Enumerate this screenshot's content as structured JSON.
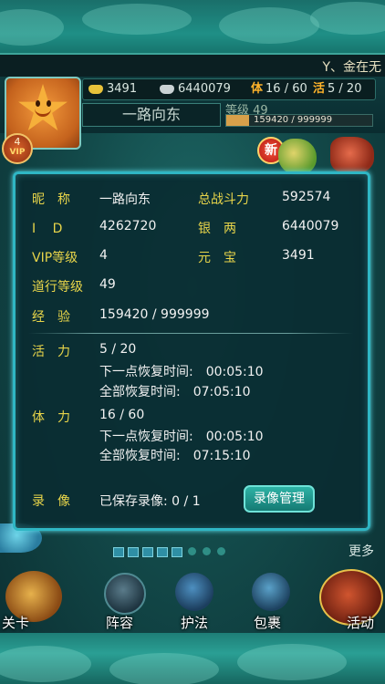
{
  "marquee": {
    "text": "Y、金在无"
  },
  "header": {
    "ingot": "3491",
    "silver": "6440079",
    "stamina_char": "体",
    "stamina": "16 / 60",
    "vitality_char": "活",
    "vitality": "5 / 20",
    "player_name": "一路向东",
    "level_label": "等级 49",
    "exp_text": "159420 / 999999",
    "exp_fraction": 0.159,
    "vip_level": "4",
    "vip_label": "VIP",
    "new_badge": "新"
  },
  "dialog": {
    "nickname_label": "昵　称",
    "nickname": "一路向东",
    "power_label": "总战斗力",
    "power": "592574",
    "id_label": "I　 D",
    "id": "4262720",
    "silver_label": "银　两",
    "silver": "6440079",
    "vip_label": "VIP等级",
    "vip": "4",
    "ingot_label": "元　宝",
    "ingot": "3491",
    "dao_label": "道行等级",
    "dao": "49",
    "exp_label": "经　验",
    "exp": "159420 / 999999",
    "vitality_label": "活　力",
    "vitality": "5 / 20",
    "vitality_next": "下一点恢复时间:　00:05:10",
    "vitality_full": "全部恢复时间:　07:05:10",
    "stamina_label": "体　力",
    "stamina": "16 / 60",
    "stamina_next": "下一点恢复时间:　00:05:10",
    "stamina_full": "全部恢复时间:　07:15:10",
    "replay_label": "录　像",
    "replay_saved": "已保存录像: 0 / 1",
    "replay_button": "录像管理"
  },
  "pager": {
    "more": "更多"
  },
  "menu": {
    "items": [
      {
        "label": "关卡"
      },
      {
        "label": "阵容"
      },
      {
        "label": "护法"
      },
      {
        "label": "包裹"
      },
      {
        "label": "活动"
      }
    ]
  },
  "colors": {
    "accent_border": "#2fb6c4",
    "label_yellow": "#e8d54a",
    "value_white": "#f2f2f2",
    "button_teal": "#2eb3a6"
  }
}
